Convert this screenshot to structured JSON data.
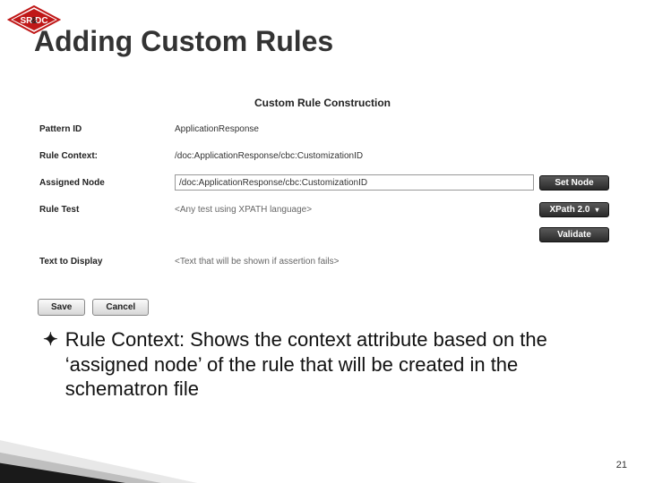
{
  "logo": {
    "text": "SR&DC"
  },
  "title": "Adding Custom Rules",
  "panel": {
    "heading": "Custom Rule Construction",
    "rows": {
      "pattern_id": {
        "label": "Pattern ID",
        "value": "ApplicationResponse"
      },
      "rule_context": {
        "label": "Rule Context:",
        "value": "/doc:ApplicationResponse/cbc:CustomizationID"
      },
      "assigned_node": {
        "label": "Assigned Node",
        "value": "/doc:ApplicationResponse/cbc:CustomizationID",
        "button": "Set Node"
      },
      "rule_test": {
        "label": "Rule Test",
        "placeholder": "<Any test using XPATH language>",
        "button": "XPath 2.0",
        "button2": "Validate"
      },
      "text_display": {
        "label": "Text to Display",
        "placeholder": "<Text that will be shown if assertion fails>"
      }
    },
    "actions": {
      "save": "Save",
      "cancel": "Cancel"
    }
  },
  "bullet": "Rule Context: Shows the context attribute based on the ‘assigned node’ of the rule that will be created in the schematron file",
  "page": "21"
}
